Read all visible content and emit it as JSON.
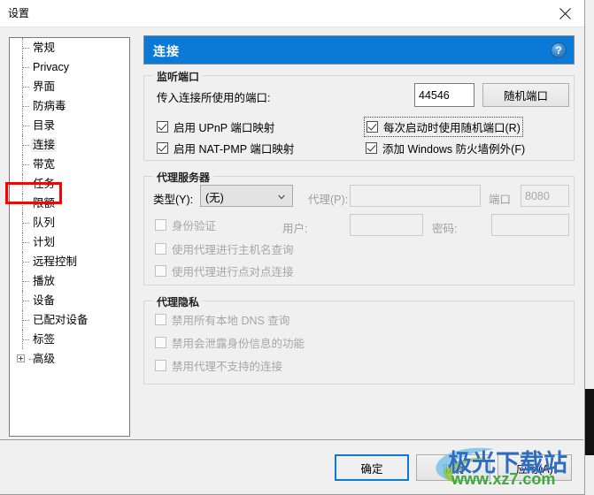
{
  "window": {
    "title": "设置",
    "close_icon": "close-icon"
  },
  "sidebar": {
    "items": [
      {
        "label": "常规",
        "selected": false,
        "expander": false
      },
      {
        "label": "Privacy",
        "selected": false,
        "expander": false
      },
      {
        "label": "界面",
        "selected": false,
        "expander": false
      },
      {
        "label": "防病毒",
        "selected": false,
        "expander": false
      },
      {
        "label": "目录",
        "selected": false,
        "expander": false
      },
      {
        "label": "连接",
        "selected": true,
        "expander": false
      },
      {
        "label": "带宽",
        "selected": false,
        "expander": false
      },
      {
        "label": "任务",
        "selected": false,
        "expander": false
      },
      {
        "label": "限额",
        "selected": false,
        "expander": false
      },
      {
        "label": "队列",
        "selected": false,
        "expander": false
      },
      {
        "label": "计划",
        "selected": false,
        "expander": false
      },
      {
        "label": "远程控制",
        "selected": false,
        "expander": false
      },
      {
        "label": "播放",
        "selected": false,
        "expander": false
      },
      {
        "label": "设备",
        "selected": false,
        "expander": false
      },
      {
        "label": "已配对设备",
        "selected": false,
        "expander": false
      },
      {
        "label": "标签",
        "selected": false,
        "expander": false
      },
      {
        "label": "高级",
        "selected": false,
        "expander": true
      }
    ],
    "highlight": {
      "target": "任务",
      "color": "#ff0000"
    }
  },
  "page": {
    "header_title": "连接",
    "header_color": "#0a7ad6",
    "help_icon_glyph": "?"
  },
  "listen_ports": {
    "group_title": "监听端口",
    "incoming_port_label": "传入连接所使用的端口:",
    "port_value": "44546",
    "random_port_button": "随机端口",
    "enable_upnp": {
      "label": "启用 UPnP 端口映射",
      "checked": true
    },
    "enable_natpmp": {
      "label": "启用 NAT-PMP 端口映射",
      "checked": true
    },
    "random_on_start": {
      "label": "每次启动时使用随机端口(R)",
      "checked": true,
      "focused": true
    },
    "add_firewall_exception": {
      "label": "添加 Windows 防火墙例外(F)",
      "checked": true
    }
  },
  "proxy_server": {
    "group_title": "代理服务器",
    "type_label": "类型(Y):",
    "type_value": "(无)",
    "proxy_label": "代理(P):",
    "proxy_value": "",
    "port_label": "端口",
    "port_value": "8080",
    "auth": {
      "label": "身份验证",
      "checked": false,
      "disabled": true
    },
    "user_label": "用户:",
    "user_value": "",
    "password_label": "密码:",
    "password_value": "",
    "use_proxy_hostname": {
      "label": "使用代理进行主机名查询",
      "checked": false,
      "disabled": true
    },
    "use_proxy_p2p": {
      "label": "使用代理进行点对点连接",
      "checked": false,
      "disabled": true
    }
  },
  "proxy_privacy": {
    "group_title": "代理隐私",
    "disable_local_dns": {
      "label": "禁用所有本地 DNS 查询",
      "checked": false,
      "disabled": true
    },
    "disable_identity_leak": {
      "label": "禁用会泄露身份信息的功能",
      "checked": false,
      "disabled": true
    },
    "disable_unsupported": {
      "label": "禁用代理不支持的连接",
      "checked": false,
      "disabled": true
    }
  },
  "footer": {
    "ok_button": "确定",
    "cancel_button": "取消",
    "apply_button": "应用(A)"
  },
  "watermark": {
    "text": "极光下载站",
    "url": "www.xz7.com",
    "text_color": "#2d6cc0",
    "url_color": "#3ea73e"
  }
}
